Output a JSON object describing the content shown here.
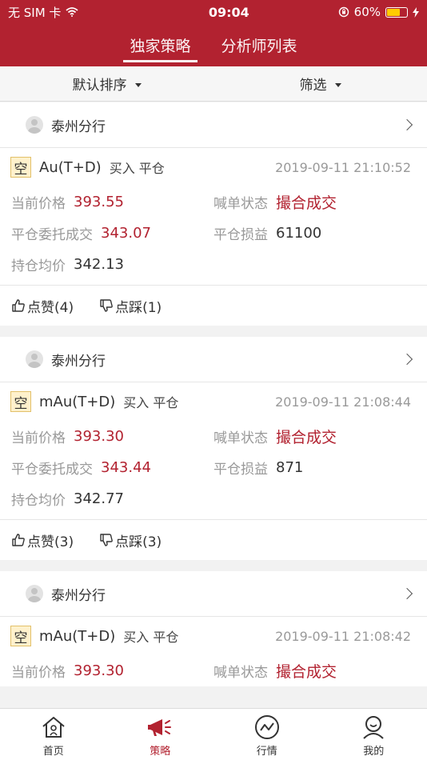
{
  "status_bar": {
    "carrier": "无 SIM 卡",
    "time": "09:04",
    "battery": "60%",
    "battery_level": 0.6
  },
  "nav": {
    "tabs": [
      {
        "label": "独家策略",
        "active": true
      },
      {
        "label": "分析师列表",
        "active": false
      }
    ]
  },
  "filter": {
    "sort_label": "默认排序",
    "filter_label": "筛选"
  },
  "cards": [
    {
      "branch": "泰州分行",
      "tag": "空",
      "symbol": "Au(T+D)",
      "action": "买入 平仓",
      "time": "2019-09-11 21:10:52",
      "current_price_label": "当前价格",
      "current_price": "393.55",
      "order_status_label": "喊单状态",
      "order_status": "撮合成交",
      "close_deal_label": "平仓委托成交",
      "close_deal": "343.07",
      "pnl_label": "平仓损益",
      "pnl": "61100",
      "avg_cost_label": "持仓均价",
      "avg_cost": "342.13",
      "like": "点赞(4)",
      "dislike": "点踩(1)"
    },
    {
      "branch": "泰州分行",
      "tag": "空",
      "symbol": "mAu(T+D)",
      "action": "买入 平仓",
      "time": "2019-09-11 21:08:44",
      "current_price_label": "当前价格",
      "current_price": "393.30",
      "order_status_label": "喊单状态",
      "order_status": "撮合成交",
      "close_deal_label": "平仓委托成交",
      "close_deal": "343.44",
      "pnl_label": "平仓损益",
      "pnl": "871",
      "avg_cost_label": "持仓均价",
      "avg_cost": "342.77",
      "like": "点赞(3)",
      "dislike": "点踩(3)"
    },
    {
      "branch": "泰州分行",
      "tag": "空",
      "symbol": "mAu(T+D)",
      "action": "买入 平仓",
      "time": "2019-09-11 21:08:42",
      "current_price_label": "当前价格",
      "current_price": "393.30",
      "order_status_label": "喊单状态",
      "order_status": "撮合成交"
    }
  ],
  "tabbar": {
    "items": [
      {
        "label": "首页",
        "icon": "home-icon"
      },
      {
        "label": "策略",
        "icon": "megaphone-icon",
        "active": true
      },
      {
        "label": "行情",
        "icon": "chart-icon"
      },
      {
        "label": "我的",
        "icon": "user-icon"
      }
    ]
  },
  "colors": {
    "brand": "#b22230",
    "tag_bg": "#fff1cc"
  }
}
